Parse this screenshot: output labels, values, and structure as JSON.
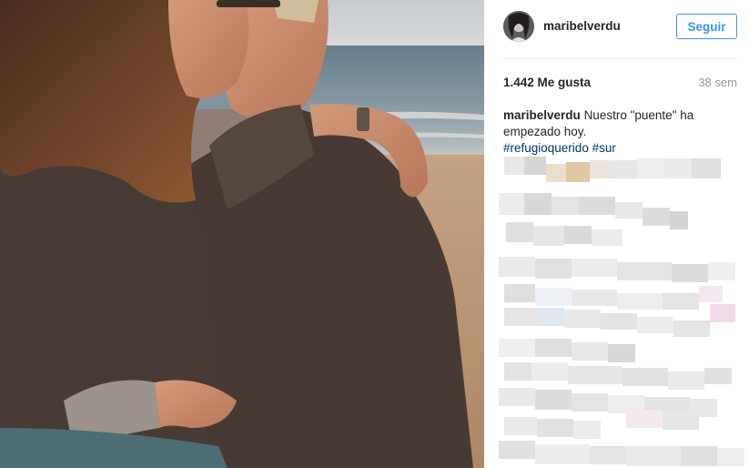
{
  "post": {
    "username": "maribelverdu",
    "follow_label": "Seguir",
    "likes": "1.442 Me gusta",
    "time_ago": "38 sem",
    "caption": {
      "username": "maribelverdu",
      "text": "Nuestro \"puente\" ha empezado hoy.",
      "hashtags": [
        "#refugioquerido",
        "#sur"
      ]
    }
  },
  "colors": {
    "accent": "#3897f0",
    "hashtag": "#003569",
    "muted": "#999999"
  },
  "icons": {
    "avatar": "profile-photo"
  }
}
